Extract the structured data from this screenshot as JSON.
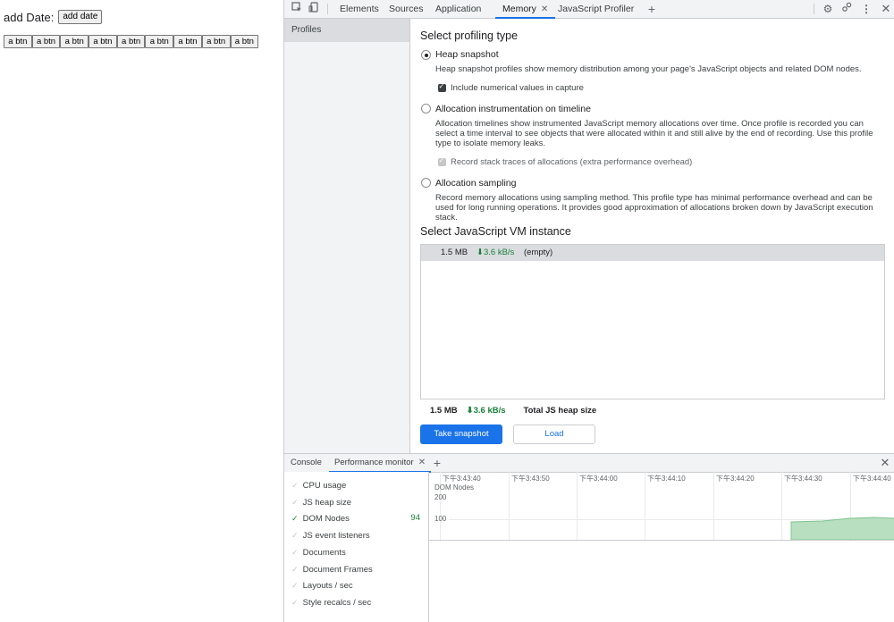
{
  "page": {
    "date_label": "add Date:",
    "add_date_button": "add date",
    "buttons": [
      "a btn",
      "a btn",
      "a btn",
      "a btn",
      "a btn",
      "a btn",
      "a btn",
      "a btn",
      "a btn"
    ]
  },
  "devtools": {
    "tabs": [
      "Elements",
      "Sources",
      "Application",
      "Memory",
      "JavaScript Profiler"
    ],
    "active_tab": "Memory",
    "sidebar": {
      "profiles_label": "Profiles"
    },
    "memory": {
      "select_type_title": "Select profiling type",
      "heap_snapshot": {
        "label": "Heap snapshot",
        "desc": "Heap snapshot profiles show memory distribution among your page's JavaScript objects and related DOM nodes.",
        "option": "Include numerical values in capture"
      },
      "allocation_timeline": {
        "label": "Allocation instrumentation on timeline",
        "desc": "Allocation timelines show instrumented JavaScript memory allocations over time. Once profile is recorded you can select a time interval to see objects that were allocated within it and still alive by the end of recording. Use this profile type to isolate memory leaks.",
        "option": "Record stack traces of allocations (extra performance overhead)"
      },
      "allocation_sampling": {
        "label": "Allocation sampling",
        "desc": "Record memory allocations using sampling method. This profile type has minimal performance overhead and can be used for long running operations. It provides good approximation of allocations broken down by JavaScript execution stack."
      },
      "vm_title": "Select JavaScript VM instance",
      "vm_row": {
        "size": "1.5 MB",
        "rate": "3.6 kB/s",
        "name": "(empty)"
      },
      "summary": {
        "size": "1.5 MB",
        "rate": "3.6 kB/s",
        "label": "Total JS heap size"
      },
      "take_snapshot": "Take snapshot",
      "load": "Load"
    },
    "drawer": {
      "tabs": [
        "Console",
        "Performance monitor"
      ],
      "active_tab": "Performance monitor",
      "metrics": [
        {
          "label": "CPU usage",
          "checked": false
        },
        {
          "label": "JS heap size",
          "checked": false
        },
        {
          "label": "DOM Nodes",
          "checked": true,
          "value": "94"
        },
        {
          "label": "JS event listeners",
          "checked": false
        },
        {
          "label": "Documents",
          "checked": false
        },
        {
          "label": "Document Frames",
          "checked": false
        },
        {
          "label": "Layouts / sec",
          "checked": false
        },
        {
          "label": "Style recalcs / sec",
          "checked": false
        }
      ],
      "time_ticks": [
        "下午3:43:40",
        "下午3:43:50",
        "下午3:44:00",
        "下午3:44:10",
        "下午3:44:20",
        "下午3:44:30",
        "下午3:44:40"
      ],
      "chart_series_label": "DOM Nodes",
      "y_ticks": [
        "200",
        "100"
      ]
    }
  },
  "colors": {
    "accent": "#1a73e8",
    "positive": "#188038",
    "chart_fill": "#b7dfc0"
  }
}
